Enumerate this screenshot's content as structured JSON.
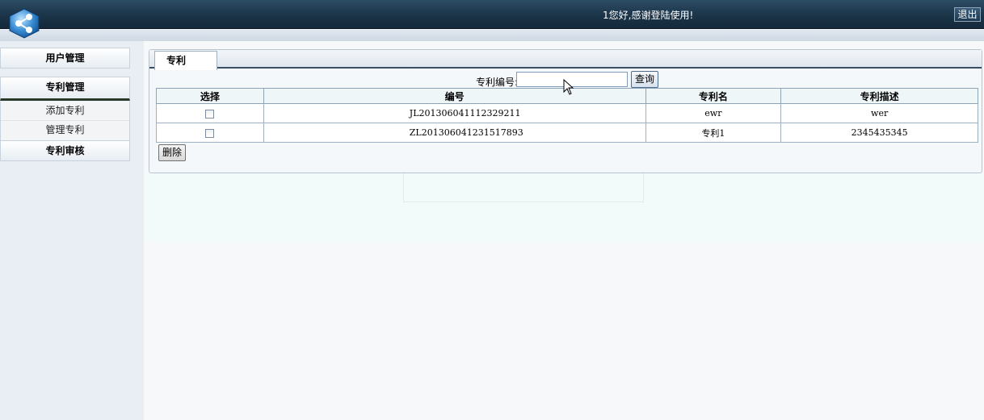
{
  "header": {
    "greeting": "1您好,感谢登陆使用!",
    "logout_label": "退出"
  },
  "sidebar": {
    "items": [
      {
        "label": "用户管理"
      },
      {
        "label": "专利管理",
        "active": true
      },
      {
        "label": "专利审核"
      }
    ],
    "submenu": [
      {
        "label": "添加专利"
      },
      {
        "label": "管理专利"
      }
    ]
  },
  "main": {
    "tab_label": "专利",
    "search": {
      "label": "专利编号:",
      "value": "",
      "button_label": "查询"
    },
    "table": {
      "headers": [
        "选择",
        "编号",
        "专利名",
        "专利描述"
      ],
      "rows": [
        {
          "code": "JL201306041112329211",
          "name": "ewr",
          "desc": "wer"
        },
        {
          "code": "ZL201306041231517893",
          "name": "专利1",
          "desc": "2345435345"
        }
      ]
    },
    "delete_label": "删除"
  },
  "colors": {
    "topbar": "#1b3448",
    "accent_border": "#3a4f63",
    "header_row": "#eef6f8"
  }
}
